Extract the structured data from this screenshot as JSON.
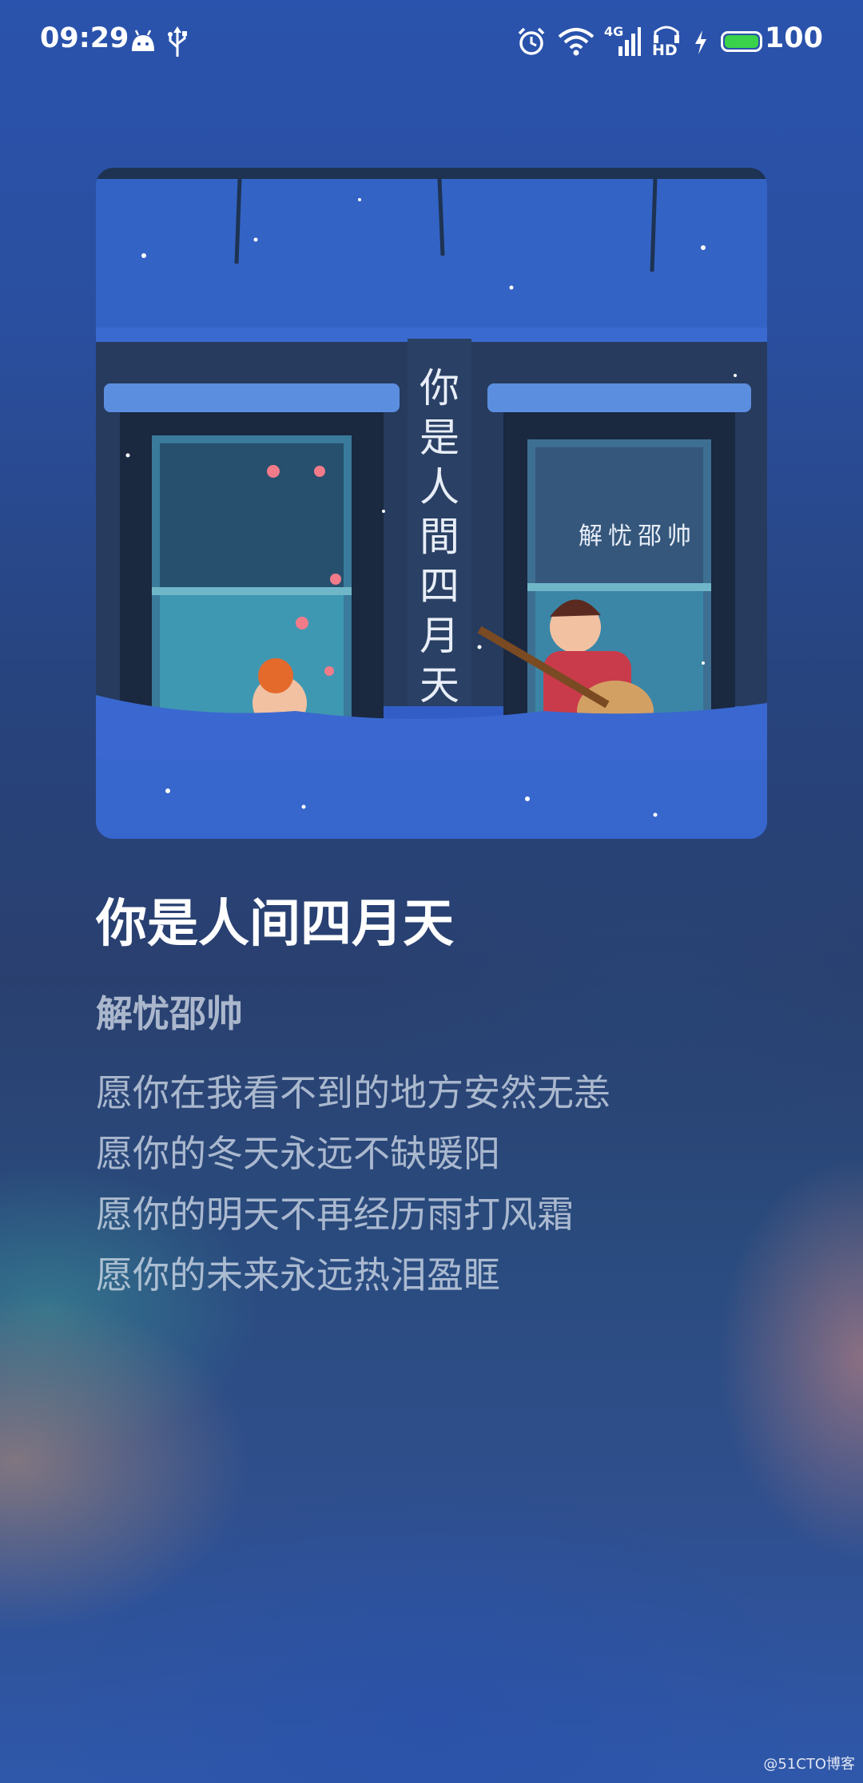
{
  "status_bar": {
    "time": "09:29",
    "battery_percent": "100",
    "battery_level": 1.0,
    "network_label": "4G",
    "hd_label": "HD",
    "icons": [
      "android-icon",
      "usb-icon",
      "alarm-icon",
      "wifi-icon",
      "signal-icon",
      "hd-icon",
      "charging-icon",
      "battery-icon"
    ]
  },
  "album": {
    "cover_vertical_title": "你是人間四月天",
    "cover_artist_text": "解忧邵帅"
  },
  "song": {
    "title": "你是人间四月天",
    "artist": "解忧邵帅"
  },
  "lyrics": [
    "愿你在我看不到的地方安然无恙",
    "愿你的冬天永远不缺暖阳",
    "愿你的明天不再经历雨打风霜",
    "愿你的未来永远热泪盈眶"
  ],
  "watermark": "@51CTO博客",
  "colors": {
    "battery_fill": "#3ad24a",
    "text_primary": "#ffffff",
    "text_secondary": "#c8d0dc"
  }
}
